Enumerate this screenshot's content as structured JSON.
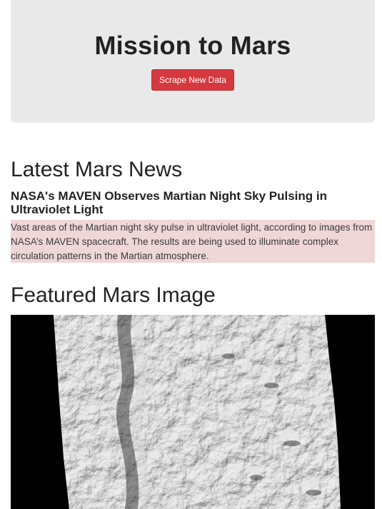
{
  "header": {
    "title": "Mission to Mars",
    "scrape_button_label": "Scrape New Data"
  },
  "news": {
    "section_heading": "Latest Mars News",
    "title": "NASA's MAVEN Observes Martian Night Sky Pulsing in Ultraviolet Light",
    "paragraph": "Vast areas of the Martian night sky pulse in ultraviolet light, according to images from NASA’s MAVEN spacecraft. The results are being used to illuminate complex circulation patterns in the Martian atmosphere."
  },
  "featured_image": {
    "section_heading": "Featured Mars Image"
  },
  "colors": {
    "jumbotron_bg": "#e9e9e9",
    "button_bg": "#d5393f",
    "news_highlight_bg": "#efd6d7"
  }
}
